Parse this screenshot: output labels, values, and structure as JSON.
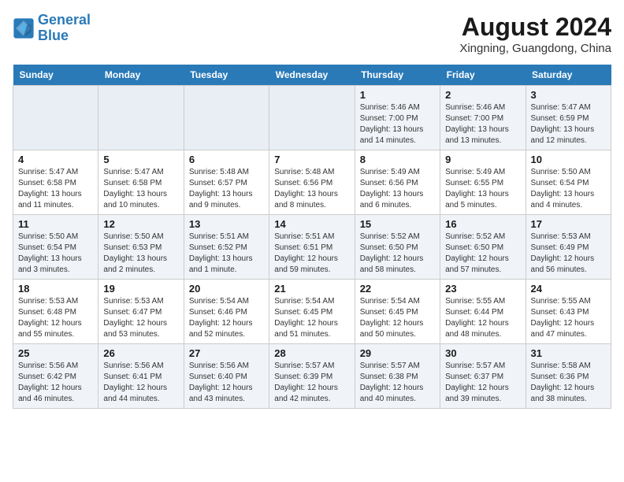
{
  "logo": {
    "line1": "General",
    "line2": "Blue"
  },
  "title": "August 2024",
  "location": "Xingning, Guangdong, China",
  "weekdays": [
    "Sunday",
    "Monday",
    "Tuesday",
    "Wednesday",
    "Thursday",
    "Friday",
    "Saturday"
  ],
  "weeks": [
    [
      {
        "day": "",
        "info": ""
      },
      {
        "day": "",
        "info": ""
      },
      {
        "day": "",
        "info": ""
      },
      {
        "day": "",
        "info": ""
      },
      {
        "day": "1",
        "info": "Sunrise: 5:46 AM\nSunset: 7:00 PM\nDaylight: 13 hours\nand 14 minutes."
      },
      {
        "day": "2",
        "info": "Sunrise: 5:46 AM\nSunset: 7:00 PM\nDaylight: 13 hours\nand 13 minutes."
      },
      {
        "day": "3",
        "info": "Sunrise: 5:47 AM\nSunset: 6:59 PM\nDaylight: 13 hours\nand 12 minutes."
      }
    ],
    [
      {
        "day": "4",
        "info": "Sunrise: 5:47 AM\nSunset: 6:58 PM\nDaylight: 13 hours\nand 11 minutes."
      },
      {
        "day": "5",
        "info": "Sunrise: 5:47 AM\nSunset: 6:58 PM\nDaylight: 13 hours\nand 10 minutes."
      },
      {
        "day": "6",
        "info": "Sunrise: 5:48 AM\nSunset: 6:57 PM\nDaylight: 13 hours\nand 9 minutes."
      },
      {
        "day": "7",
        "info": "Sunrise: 5:48 AM\nSunset: 6:56 PM\nDaylight: 13 hours\nand 8 minutes."
      },
      {
        "day": "8",
        "info": "Sunrise: 5:49 AM\nSunset: 6:56 PM\nDaylight: 13 hours\nand 6 minutes."
      },
      {
        "day": "9",
        "info": "Sunrise: 5:49 AM\nSunset: 6:55 PM\nDaylight: 13 hours\nand 5 minutes."
      },
      {
        "day": "10",
        "info": "Sunrise: 5:50 AM\nSunset: 6:54 PM\nDaylight: 13 hours\nand 4 minutes."
      }
    ],
    [
      {
        "day": "11",
        "info": "Sunrise: 5:50 AM\nSunset: 6:54 PM\nDaylight: 13 hours\nand 3 minutes."
      },
      {
        "day": "12",
        "info": "Sunrise: 5:50 AM\nSunset: 6:53 PM\nDaylight: 13 hours\nand 2 minutes."
      },
      {
        "day": "13",
        "info": "Sunrise: 5:51 AM\nSunset: 6:52 PM\nDaylight: 13 hours\nand 1 minute."
      },
      {
        "day": "14",
        "info": "Sunrise: 5:51 AM\nSunset: 6:51 PM\nDaylight: 12 hours\nand 59 minutes."
      },
      {
        "day": "15",
        "info": "Sunrise: 5:52 AM\nSunset: 6:50 PM\nDaylight: 12 hours\nand 58 minutes."
      },
      {
        "day": "16",
        "info": "Sunrise: 5:52 AM\nSunset: 6:50 PM\nDaylight: 12 hours\nand 57 minutes."
      },
      {
        "day": "17",
        "info": "Sunrise: 5:53 AM\nSunset: 6:49 PM\nDaylight: 12 hours\nand 56 minutes."
      }
    ],
    [
      {
        "day": "18",
        "info": "Sunrise: 5:53 AM\nSunset: 6:48 PM\nDaylight: 12 hours\nand 55 minutes."
      },
      {
        "day": "19",
        "info": "Sunrise: 5:53 AM\nSunset: 6:47 PM\nDaylight: 12 hours\nand 53 minutes."
      },
      {
        "day": "20",
        "info": "Sunrise: 5:54 AM\nSunset: 6:46 PM\nDaylight: 12 hours\nand 52 minutes."
      },
      {
        "day": "21",
        "info": "Sunrise: 5:54 AM\nSunset: 6:45 PM\nDaylight: 12 hours\nand 51 minutes."
      },
      {
        "day": "22",
        "info": "Sunrise: 5:54 AM\nSunset: 6:45 PM\nDaylight: 12 hours\nand 50 minutes."
      },
      {
        "day": "23",
        "info": "Sunrise: 5:55 AM\nSunset: 6:44 PM\nDaylight: 12 hours\nand 48 minutes."
      },
      {
        "day": "24",
        "info": "Sunrise: 5:55 AM\nSunset: 6:43 PM\nDaylight: 12 hours\nand 47 minutes."
      }
    ],
    [
      {
        "day": "25",
        "info": "Sunrise: 5:56 AM\nSunset: 6:42 PM\nDaylight: 12 hours\nand 46 minutes."
      },
      {
        "day": "26",
        "info": "Sunrise: 5:56 AM\nSunset: 6:41 PM\nDaylight: 12 hours\nand 44 minutes."
      },
      {
        "day": "27",
        "info": "Sunrise: 5:56 AM\nSunset: 6:40 PM\nDaylight: 12 hours\nand 43 minutes."
      },
      {
        "day": "28",
        "info": "Sunrise: 5:57 AM\nSunset: 6:39 PM\nDaylight: 12 hours\nand 42 minutes."
      },
      {
        "day": "29",
        "info": "Sunrise: 5:57 AM\nSunset: 6:38 PM\nDaylight: 12 hours\nand 40 minutes."
      },
      {
        "day": "30",
        "info": "Sunrise: 5:57 AM\nSunset: 6:37 PM\nDaylight: 12 hours\nand 39 minutes."
      },
      {
        "day": "31",
        "info": "Sunrise: 5:58 AM\nSunset: 6:36 PM\nDaylight: 12 hours\nand 38 minutes."
      }
    ]
  ]
}
